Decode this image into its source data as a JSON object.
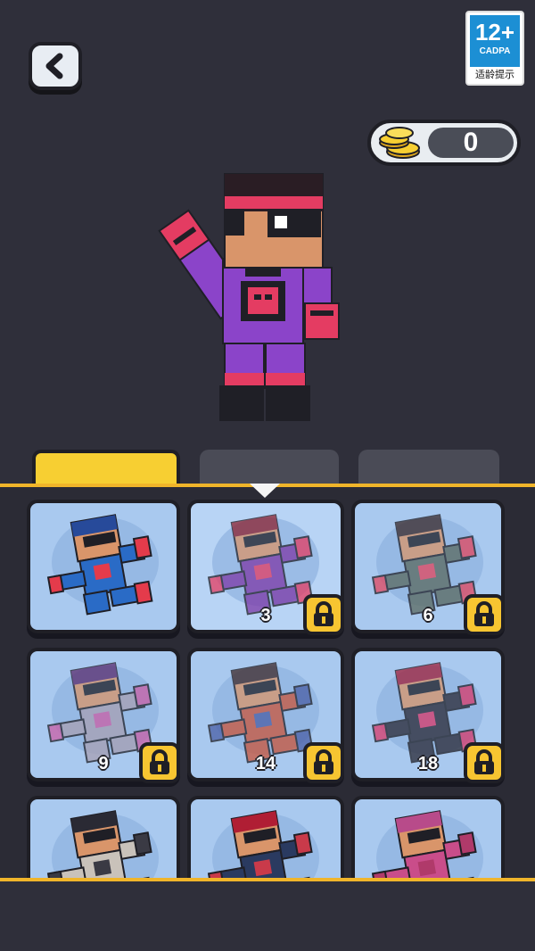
{
  "age_rating": {
    "label": "12+",
    "org": "CADPA",
    "note": "适龄提示",
    "color": "#1c8fd4"
  },
  "coins": {
    "count": "0"
  },
  "tabs": [
    {
      "label": "",
      "active": true
    },
    {
      "label": "",
      "active": false
    },
    {
      "label": "",
      "active": false
    }
  ],
  "skins": [
    {
      "requirement": "",
      "locked": false,
      "selected": false,
      "main": "#2a6bc6",
      "accent": "#e43b4b",
      "hair": "#274a9a"
    },
    {
      "requirement": "3",
      "locked": true,
      "selected": true,
      "main": "#7d3aa8",
      "accent": "#e43c62",
      "hair": "#8b2230"
    },
    {
      "requirement": "6",
      "locked": true,
      "selected": false,
      "main": "#5b6a5f",
      "accent": "#e2475e",
      "hair": "#3a2a2a"
    },
    {
      "requirement": "9",
      "locked": true,
      "selected": false,
      "main": "#a8a0b3",
      "accent": "#c95fa6",
      "hair": "#5b2d6f"
    },
    {
      "requirement": "14",
      "locked": true,
      "selected": false,
      "main": "#c9563b",
      "accent": "#4a5fa6",
      "hair": "#3f2a2a"
    },
    {
      "requirement": "18",
      "locked": true,
      "selected": false,
      "main": "#2a2a36",
      "accent": "#d83a6a",
      "hair": "#a0203a"
    },
    {
      "requirement": "",
      "locked": false,
      "selected": false,
      "main": "#c9c2ba",
      "accent": "#3a3a44",
      "hair": "#2a2a34"
    },
    {
      "requirement": "",
      "locked": false,
      "selected": false,
      "main": "#2a3a60",
      "accent": "#c93a4a",
      "hair": "#b01e34"
    },
    {
      "requirement": "",
      "locked": false,
      "selected": false,
      "main": "#c94d8a",
      "accent": "#b03a6a",
      "hair": "#b84b8a"
    }
  ],
  "colors": {
    "background": "#2f2f3a",
    "tab_active": "#f7cf32",
    "card": "#a9c9ef",
    "panel_border": "#f0b52a"
  }
}
